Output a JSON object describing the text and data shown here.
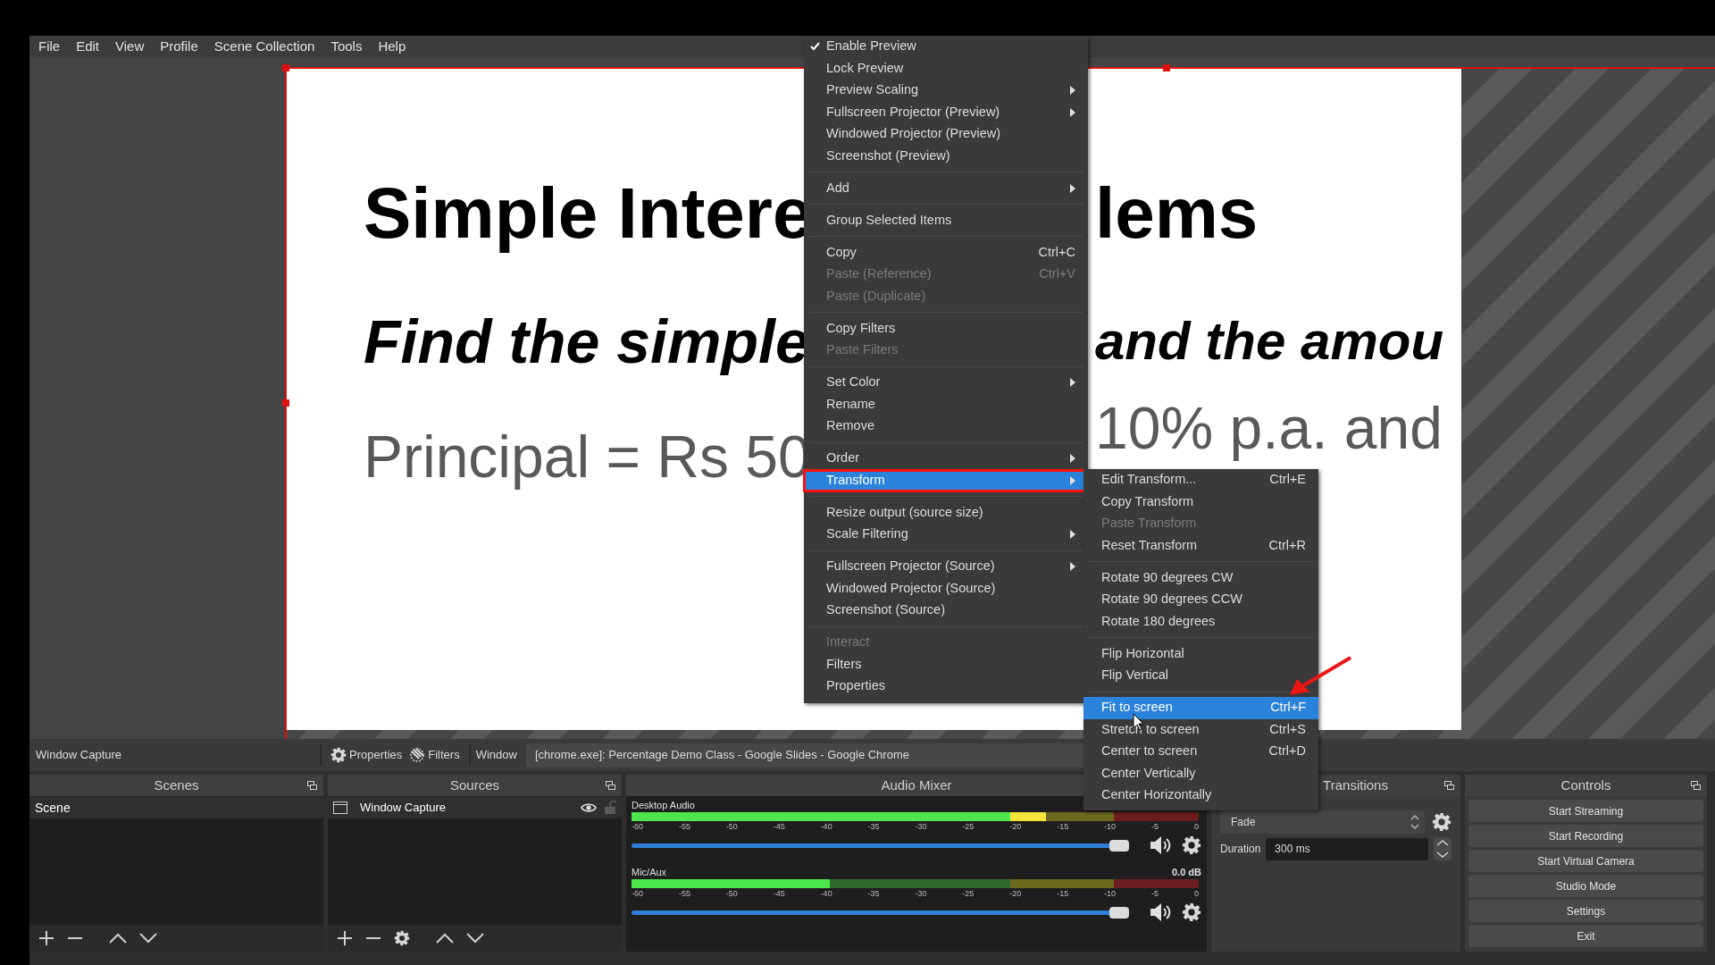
{
  "menubar": [
    "File",
    "Edit",
    "View",
    "Profile",
    "Scene Collection",
    "Tools",
    "Help"
  ],
  "preview": {
    "slide_lines": [
      {
        "kind": "title",
        "left": "Simple Intere",
        "right": "lems"
      },
      {
        "kind": "subtitle",
        "left": "Find the simple",
        "right": "and the amou"
      },
      {
        "kind": "body",
        "left": "Principal = Rs 50",
        "right": "10% p.a. and"
      }
    ]
  },
  "context_menu": {
    "items": [
      {
        "kind": "item",
        "label": "Enable Preview",
        "checked": true,
        "disabled": false,
        "submenu": false,
        "selected": false
      },
      {
        "kind": "item",
        "label": "Lock Preview",
        "checked": false,
        "disabled": false,
        "submenu": false,
        "selected": false
      },
      {
        "kind": "item",
        "label": "Preview Scaling",
        "checked": false,
        "disabled": false,
        "submenu": true,
        "selected": false
      },
      {
        "kind": "item",
        "label": "Fullscreen Projector (Preview)",
        "checked": false,
        "disabled": false,
        "submenu": true,
        "selected": false
      },
      {
        "kind": "item",
        "label": "Windowed Projector (Preview)",
        "checked": false,
        "disabled": false,
        "submenu": false,
        "selected": false
      },
      {
        "kind": "item",
        "label": "Screenshot (Preview)",
        "checked": false,
        "disabled": false,
        "submenu": false,
        "selected": false
      },
      {
        "kind": "separator"
      },
      {
        "kind": "item",
        "label": "Add",
        "checked": false,
        "disabled": false,
        "submenu": true,
        "selected": false
      },
      {
        "kind": "separator"
      },
      {
        "kind": "item",
        "label": "Group Selected Items",
        "checked": false,
        "disabled": false,
        "submenu": false,
        "selected": false
      },
      {
        "kind": "separator"
      },
      {
        "kind": "item",
        "label": "Copy",
        "shortcut": "Ctrl+C",
        "checked": false,
        "disabled": false,
        "submenu": false,
        "selected": false
      },
      {
        "kind": "item",
        "label": "Paste (Reference)",
        "shortcut": "Ctrl+V",
        "checked": false,
        "disabled": true,
        "submenu": false,
        "selected": false
      },
      {
        "kind": "item",
        "label": "Paste (Duplicate)",
        "checked": false,
        "disabled": true,
        "submenu": false,
        "selected": false
      },
      {
        "kind": "separator"
      },
      {
        "kind": "item",
        "label": "Copy Filters",
        "checked": false,
        "disabled": false,
        "submenu": false,
        "selected": false
      },
      {
        "kind": "item",
        "label": "Paste Filters",
        "checked": false,
        "disabled": true,
        "submenu": false,
        "selected": false
      },
      {
        "kind": "separator"
      },
      {
        "kind": "item",
        "label": "Set Color",
        "checked": false,
        "disabled": false,
        "submenu": true,
        "selected": false
      },
      {
        "kind": "item",
        "label": "Rename",
        "checked": false,
        "disabled": false,
        "submenu": false,
        "selected": false
      },
      {
        "kind": "item",
        "label": "Remove",
        "checked": false,
        "disabled": false,
        "submenu": false,
        "selected": false
      },
      {
        "kind": "separator"
      },
      {
        "kind": "item",
        "label": "Order",
        "checked": false,
        "disabled": false,
        "submenu": true,
        "selected": false
      },
      {
        "kind": "item",
        "label": "Transform",
        "checked": false,
        "disabled": false,
        "submenu": true,
        "selected": true
      },
      {
        "kind": "separator"
      },
      {
        "kind": "item",
        "label": "Resize output (source size)",
        "checked": false,
        "disabled": false,
        "submenu": false,
        "selected": false
      },
      {
        "kind": "item",
        "label": "Scale Filtering",
        "checked": false,
        "disabled": false,
        "submenu": true,
        "selected": false
      },
      {
        "kind": "separator"
      },
      {
        "kind": "item",
        "label": "Fullscreen Projector (Source)",
        "checked": false,
        "disabled": false,
        "submenu": true,
        "selected": false
      },
      {
        "kind": "item",
        "label": "Windowed Projector (Source)",
        "checked": false,
        "disabled": false,
        "submenu": false,
        "selected": false
      },
      {
        "kind": "item",
        "label": "Screenshot (Source)",
        "checked": false,
        "disabled": false,
        "submenu": false,
        "selected": false
      },
      {
        "kind": "separator"
      },
      {
        "kind": "item",
        "label": "Interact",
        "checked": false,
        "disabled": true,
        "submenu": false,
        "selected": false
      },
      {
        "kind": "item",
        "label": "Filters",
        "checked": false,
        "disabled": false,
        "submenu": false,
        "selected": false
      },
      {
        "kind": "item",
        "label": "Properties",
        "checked": false,
        "disabled": false,
        "submenu": false,
        "selected": false
      }
    ]
  },
  "submenu": {
    "items": [
      {
        "kind": "item",
        "label": "Edit Transform...",
        "shortcut": "Ctrl+E",
        "disabled": false,
        "selected": false
      },
      {
        "kind": "item",
        "label": "Copy Transform",
        "disabled": false,
        "selected": false
      },
      {
        "kind": "item",
        "label": "Paste Transform",
        "disabled": true,
        "selected": false
      },
      {
        "kind": "item",
        "label": "Reset Transform",
        "shortcut": "Ctrl+R",
        "disabled": false,
        "selected": false
      },
      {
        "kind": "separator"
      },
      {
        "kind": "item",
        "label": "Rotate 90 degrees CW",
        "disabled": false,
        "selected": false
      },
      {
        "kind": "item",
        "label": "Rotate 90 degrees CCW",
        "disabled": false,
        "selected": false
      },
      {
        "kind": "item",
        "label": "Rotate 180 degrees",
        "disabled": false,
        "selected": false
      },
      {
        "kind": "separator"
      },
      {
        "kind": "item",
        "label": "Flip Horizontal",
        "disabled": false,
        "selected": false
      },
      {
        "kind": "item",
        "label": "Flip Vertical",
        "disabled": false,
        "selected": false
      },
      {
        "kind": "separator"
      },
      {
        "kind": "item",
        "label": "Fit to screen",
        "shortcut": "Ctrl+F",
        "disabled": false,
        "selected": true
      },
      {
        "kind": "item",
        "label": "Stretch to screen",
        "shortcut": "Ctrl+S",
        "disabled": false,
        "selected": false
      },
      {
        "kind": "item",
        "label": "Center to screen",
        "shortcut": "Ctrl+D",
        "disabled": false,
        "selected": false
      },
      {
        "kind": "item",
        "label": "Center Vertically",
        "disabled": false,
        "selected": false
      },
      {
        "kind": "item",
        "label": "Center Horizontally",
        "disabled": false,
        "selected": false
      }
    ]
  },
  "annotations": {
    "outline_selected_item": true,
    "arrow_to_selected_item": true
  },
  "source_toolbar": {
    "source_name": "Window Capture",
    "buttons": [
      {
        "kind": "properties",
        "label": "Properties"
      },
      {
        "kind": "filters",
        "label": "Filters"
      }
    ],
    "field_label": "Window",
    "field_value": "[chrome.exe]: Percentage Demo Class - Google Slides - Google Chrome"
  },
  "scenes": {
    "title": "Scenes",
    "items": [
      {
        "label": "Scene",
        "selected": true
      }
    ]
  },
  "sources": {
    "title": "Sources",
    "items": [
      {
        "label": "Window Capture",
        "visible": true,
        "locked": false,
        "selected": true
      }
    ]
  },
  "audio_mixer": {
    "title": "Audio Mixer",
    "channels": [
      {
        "name": "Desktop Audio",
        "meter": {
          "level": 0.73
        },
        "volume": {
          "level": 0.97
        },
        "scale": [
          "-60",
          "-55",
          "-50",
          "-45",
          "-40",
          "-35",
          "-30",
          "-25",
          "-20",
          "-15",
          "-10",
          "-5",
          "0"
        ]
      },
      {
        "name": "Mic/Aux",
        "reading": "0.0 dB",
        "meter": {
          "level": 0.35
        },
        "volume": {
          "level": 0.97
        },
        "scale": [
          "-60",
          "-55",
          "-50",
          "-45",
          "-40",
          "-35",
          "-30",
          "-25",
          "-20",
          "-15",
          "-10",
          "-5",
          "0"
        ]
      }
    ]
  },
  "transitions": {
    "title": "Transitions",
    "transition": "Fade",
    "duration_label": "Duration",
    "duration": "300 ms"
  },
  "controls": {
    "title": "Controls",
    "buttons": [
      "Start Streaming",
      "Start Recording",
      "Start Virtual Camera",
      "Studio Mode",
      "Settings",
      "Exit"
    ]
  }
}
